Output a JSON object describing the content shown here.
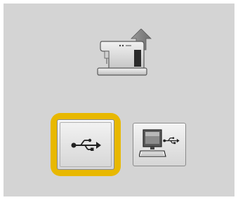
{
  "screen": {
    "header_icon": "sewing-machine-upload-icon",
    "options": [
      {
        "id": "usb",
        "icon": "usb-icon",
        "selected": true
      },
      {
        "id": "computer",
        "icon": "computer-usb-icon",
        "selected": false
      }
    ]
  },
  "colors": {
    "background": "#d4d4d4",
    "selection_highlight": "#e8b800",
    "button_face": "#e4e4e4",
    "icon_dark": "#222222"
  }
}
